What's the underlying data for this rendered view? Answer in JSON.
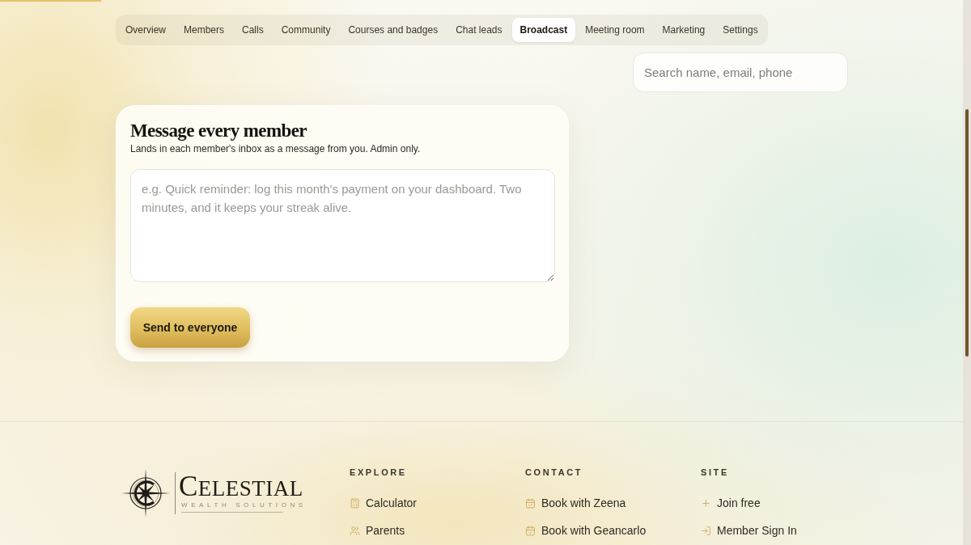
{
  "tabs": [
    {
      "label": "Overview",
      "selected": false
    },
    {
      "label": "Members",
      "selected": false
    },
    {
      "label": "Calls",
      "selected": false
    },
    {
      "label": "Community",
      "selected": false
    },
    {
      "label": "Courses and badges",
      "selected": false
    },
    {
      "label": "Chat leads",
      "selected": false
    },
    {
      "label": "Broadcast",
      "selected": true
    },
    {
      "label": "Meeting room",
      "selected": false
    },
    {
      "label": "Marketing",
      "selected": false
    },
    {
      "label": "Settings",
      "selected": false
    }
  ],
  "search": {
    "placeholder": "Search name, email, phone"
  },
  "broadcast_card": {
    "title": "Message every member",
    "subtitle": "Lands in each member's inbox as a message from you. Admin only.",
    "message": {
      "placeholder": "e.g. Quick reminder: log this month's payment on your dashboard. Two minutes, and it keeps your streak alive."
    },
    "send_button": "Send to everyone"
  },
  "footer": {
    "logo": {
      "wordmark": "CELESTIAL",
      "tagline": "WEALTH SOLUTIONS"
    },
    "columns": [
      {
        "heading": "EXPLORE",
        "links": [
          {
            "label": "Calculator",
            "kind": "calculator"
          },
          {
            "label": "Parents",
            "kind": "people"
          }
        ]
      },
      {
        "heading": "CONTACT",
        "links": [
          {
            "label": "Book with Zeena",
            "kind": "booking"
          },
          {
            "label": "Book with Geancarlo",
            "kind": "booking"
          }
        ]
      },
      {
        "heading": "SITE",
        "links": [
          {
            "label": "Join free",
            "kind": "join"
          },
          {
            "label": "Member Sign In",
            "kind": "signin"
          }
        ]
      }
    ]
  }
}
